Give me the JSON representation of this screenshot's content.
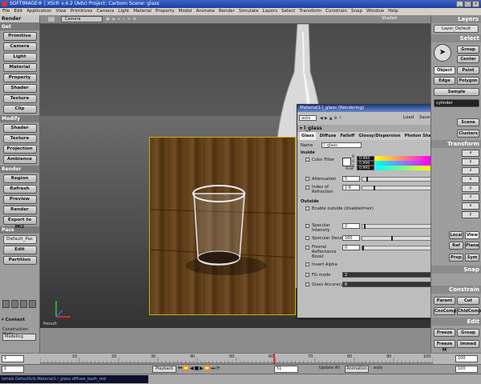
{
  "window": {
    "title": "SOFTIMAGE® | XSI® v.4.2 (Adv) Project: Cartoon   Scene: glass",
    "controls": [
      "_",
      "□",
      "×"
    ]
  },
  "menu": [
    "File",
    "Edit",
    "Application",
    "View",
    "Primitives",
    "Camera",
    "Light",
    "Material",
    "Property",
    "Model",
    "Animate",
    "Render",
    "Simulate",
    "Layers",
    "Select",
    "Transform",
    "Constrain",
    "Snap",
    "Window",
    "Help"
  ],
  "left_panel": {
    "header": "Render",
    "sections": [
      {
        "title": "Get",
        "buttons": [
          "Primitive",
          "Camera",
          "Light",
          "Material",
          "Property",
          "Shader",
          "Texture",
          "Clip"
        ]
      },
      {
        "title": "Modify",
        "buttons": [
          "Shader",
          "Texture",
          "Projection",
          "Ambience"
        ]
      },
      {
        "title": "Render",
        "buttons": [
          "Region",
          "Refresh",
          "Preview",
          "Render",
          "Export to MI2"
        ]
      },
      {
        "title": "Pass",
        "pass_value": "Default_Pas",
        "buttons": [
          "Edit",
          "Partition"
        ]
      }
    ],
    "context_label": "Context",
    "construction_label": "Construction Mode",
    "construction_value": "Modeling"
  },
  "viewport": {
    "camera_menu": "Camera",
    "shading_menu": "Shaded",
    "label": "Result"
  },
  "right_panel": {
    "layers_header": "Layers",
    "layer_value": "Layer_Default",
    "select_header": "Select",
    "select_buttons": [
      "Group",
      "Center",
      "Object",
      "Point",
      "Edge",
      "Polygon",
      "Sample"
    ],
    "selection_value": "cylinder",
    "mid_buttons": [
      "Scene",
      "Clusters"
    ],
    "transform_header": "Transform",
    "transform_buttons": [
      "Local",
      "View",
      "Ref",
      "Plane",
      "Prop",
      "Sym"
    ],
    "snap_header": "Snap",
    "constrain_header": "Constrain",
    "constrain_buttons": [
      "Parent",
      "Cut",
      "CnsComp",
      "ChldComp"
    ],
    "edit_header": "Edit",
    "edit_buttons": [
      "Freeze",
      "Group",
      "Freeze M",
      "Immed"
    ]
  },
  "material_editor": {
    "title": "Material1:l_glass (Rendering)",
    "preset": "auto",
    "load_label": "Load",
    "save_label": "Save",
    "node": "l_glass",
    "tabs": [
      "Glass",
      "Diffuse",
      "Falloff",
      "Glossy/Dispersion",
      "Photon Shader"
    ],
    "name_label": "Name",
    "name_value": "l_glass",
    "inside_label": "Inside",
    "color_filter_label": "Color Filter",
    "color_labels": [
      "R",
      "G",
      "B"
    ],
    "color_values": [
      "0.994",
      "0.996",
      "0.995"
    ],
    "rgb_label": "RGB",
    "attenuation_label": "Attenuation",
    "attenuation_value": "5",
    "ior_label": "Index of Refraction",
    "ior_value": "1.6",
    "outside_label": "Outside",
    "enable_outside_label": "Enable outside (disabled=air)",
    "specular_intensity_label": "Specular Intensity",
    "specular_intensity_value": "2",
    "specular_decay_label": "Specular Decay",
    "specular_decay_value": "160",
    "fresnel_label": "Fresnel Reflectance Boost",
    "fresnel_value": "0",
    "invert_alpha_label": "Invert Alpha",
    "fg_mode_label": "FG mode",
    "fg_mode_value": "2",
    "glass_accuracy_label": "Glass Accuracy",
    "glass_accuracy_value": "6"
  },
  "timeline": {
    "start": "1",
    "end": "100",
    "ticks": [
      "10",
      "20",
      "30",
      "40",
      "50",
      "60",
      "70",
      "80",
      "90",
      "100"
    ]
  },
  "playback": {
    "start_field": "1",
    "playback_label": "Playback",
    "frame_field": "51",
    "update_label": "Update All",
    "animation_label": "Animation",
    "auto_label": "auto",
    "end_field": "100"
  },
  "status": {
    "text": "terials.DefaultLib.Material1.l_glass.diffuse_bash_red"
  }
}
